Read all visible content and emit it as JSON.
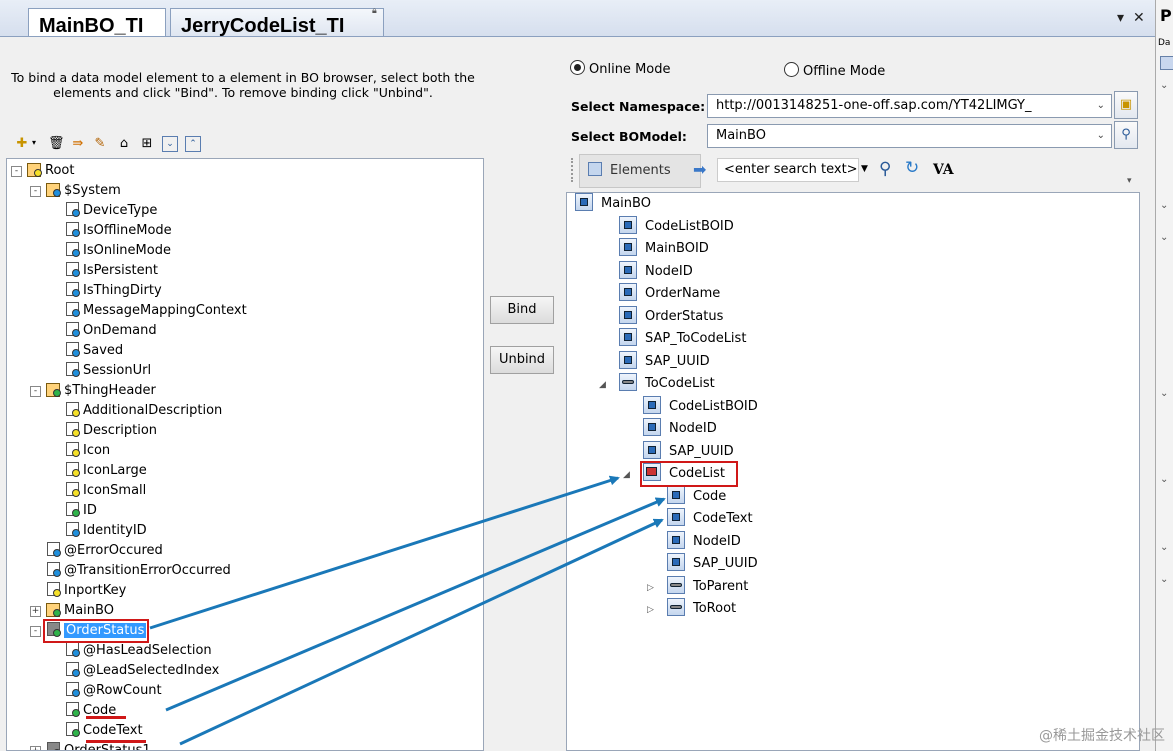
{
  "tabs": [
    {
      "label": "MainBO_TI"
    },
    {
      "label": "JerryCodeList_TI"
    }
  ],
  "window_controls": {
    "dropdown": "▾",
    "close": "✕"
  },
  "right_panel": {
    "label": "P",
    "sub": "Da"
  },
  "instruction": "To bind a data model element to a element in BO browser, select both the elements and click \"Bind\". To remove binding click \"Unbind\".",
  "left_toolbar_icons": [
    "new-icon",
    "delete-icon",
    "bind-icon",
    "edit-icon",
    "hierarchy-icon",
    "tree-icon",
    "expand-all-icon",
    "collapse-all-icon"
  ],
  "left_tree": [
    {
      "label": "Root",
      "level": 0,
      "exp": "-",
      "icon": "group"
    },
    {
      "label": "$System",
      "level": 1,
      "exp": "-",
      "icon": "group-blue"
    },
    {
      "label": "DeviceType",
      "level": 2,
      "icon": "blue"
    },
    {
      "label": "IsOfflineMode",
      "level": 2,
      "icon": "blue"
    },
    {
      "label": "IsOnlineMode",
      "level": 2,
      "icon": "blue"
    },
    {
      "label": "IsPersistent",
      "level": 2,
      "icon": "blue"
    },
    {
      "label": "IsThingDirty",
      "level": 2,
      "icon": "blue"
    },
    {
      "label": "MessageMappingContext",
      "level": 2,
      "icon": "blue"
    },
    {
      "label": "OnDemand",
      "level": 2,
      "icon": "blue"
    },
    {
      "label": "Saved",
      "level": 2,
      "icon": "blue"
    },
    {
      "label": "SessionUrl",
      "level": 2,
      "icon": "blue"
    },
    {
      "label": "$ThingHeader",
      "level": 1,
      "exp": "-",
      "icon": "group-green"
    },
    {
      "label": "AdditionalDescription",
      "level": 2,
      "icon": "yellow"
    },
    {
      "label": "Description",
      "level": 2,
      "icon": "yellow"
    },
    {
      "label": "Icon",
      "level": 2,
      "icon": "yellow"
    },
    {
      "label": "IconLarge",
      "level": 2,
      "icon": "yellow"
    },
    {
      "label": "IconSmall",
      "level": 2,
      "icon": "yellow"
    },
    {
      "label": "ID",
      "level": 2,
      "icon": "green"
    },
    {
      "label": "IdentityID",
      "level": 2,
      "icon": "blue"
    },
    {
      "label": "@ErrorOccured",
      "level": 1,
      "icon": "blue"
    },
    {
      "label": "@TransitionErrorOccurred",
      "level": 1,
      "icon": "blue"
    },
    {
      "label": "InportKey",
      "level": 1,
      "icon": "yellow"
    },
    {
      "label": "MainBO",
      "level": 1,
      "exp": "+",
      "icon": "group-green"
    },
    {
      "label": "OrderStatus",
      "level": 1,
      "exp": "-",
      "icon": "table",
      "selected": true
    },
    {
      "label": "@HasLeadSelection",
      "level": 2,
      "icon": "blue"
    },
    {
      "label": "@LeadSelectedIndex",
      "level": 2,
      "icon": "blue"
    },
    {
      "label": "@RowCount",
      "level": 2,
      "icon": "blue"
    },
    {
      "label": "Code",
      "level": 2,
      "icon": "green"
    },
    {
      "label": "CodeText",
      "level": 2,
      "icon": "green"
    },
    {
      "label": "OrderStatus1",
      "level": 1,
      "exp": "+",
      "icon": "table"
    }
  ],
  "buttons": {
    "bind": "Bind",
    "unbind": "Unbind"
  },
  "mode": {
    "online": "Online Mode",
    "offline": "Offline Mode",
    "selected": "online"
  },
  "namespace": {
    "label": "Select Namespace:",
    "value": "http://0013148251-one-off.sap.com/YT42LIMGY_"
  },
  "bomodel": {
    "label": "Select BOModel:",
    "value": "MainBO"
  },
  "right_toolbar": {
    "elements_label": "Elements",
    "search_placeholder": "<enter search text>",
    "va_label": "VA"
  },
  "right_tree": [
    {
      "label": "MainBO",
      "level": 0,
      "tri": "◢",
      "icon": "root"
    },
    {
      "label": "CodeListBOID",
      "level": 1,
      "icon": "elem"
    },
    {
      "label": "MainBOID",
      "level": 1,
      "icon": "elem"
    },
    {
      "label": "NodeID",
      "level": 1,
      "icon": "elem"
    },
    {
      "label": "OrderName",
      "level": 1,
      "icon": "elem"
    },
    {
      "label": "OrderStatus",
      "level": 1,
      "icon": "elem"
    },
    {
      "label": "SAP_ToCodeList",
      "level": 1,
      "icon": "elem"
    },
    {
      "label": "SAP_UUID",
      "level": 1,
      "icon": "elem"
    },
    {
      "label": "ToCodeList",
      "level": 1,
      "tri": "◢",
      "icon": "assoc"
    },
    {
      "label": "CodeListBOID",
      "level": 2,
      "icon": "elem"
    },
    {
      "label": "NodeID",
      "level": 2,
      "icon": "elem"
    },
    {
      "label": "SAP_UUID",
      "level": 2,
      "icon": "elem"
    },
    {
      "label": "CodeList",
      "level": 2,
      "tri": "◢",
      "icon": "node",
      "boxed": true
    },
    {
      "label": "Code",
      "level": 3,
      "icon": "elem"
    },
    {
      "label": "CodeText",
      "level": 3,
      "icon": "elem"
    },
    {
      "label": "NodeID",
      "level": 3,
      "icon": "elem"
    },
    {
      "label": "SAP_UUID",
      "level": 3,
      "icon": "elem"
    },
    {
      "label": "ToParent",
      "level": 3,
      "tri": "▷",
      "icon": "assoc"
    },
    {
      "label": "ToRoot",
      "level": 3,
      "tri": "▷",
      "icon": "assoc"
    }
  ],
  "watermark": "@稀土掘金技术社区",
  "colors": {
    "annotation_red": "#d01818",
    "arrow_blue": "#1a78b8",
    "selection": "#3399ff"
  }
}
